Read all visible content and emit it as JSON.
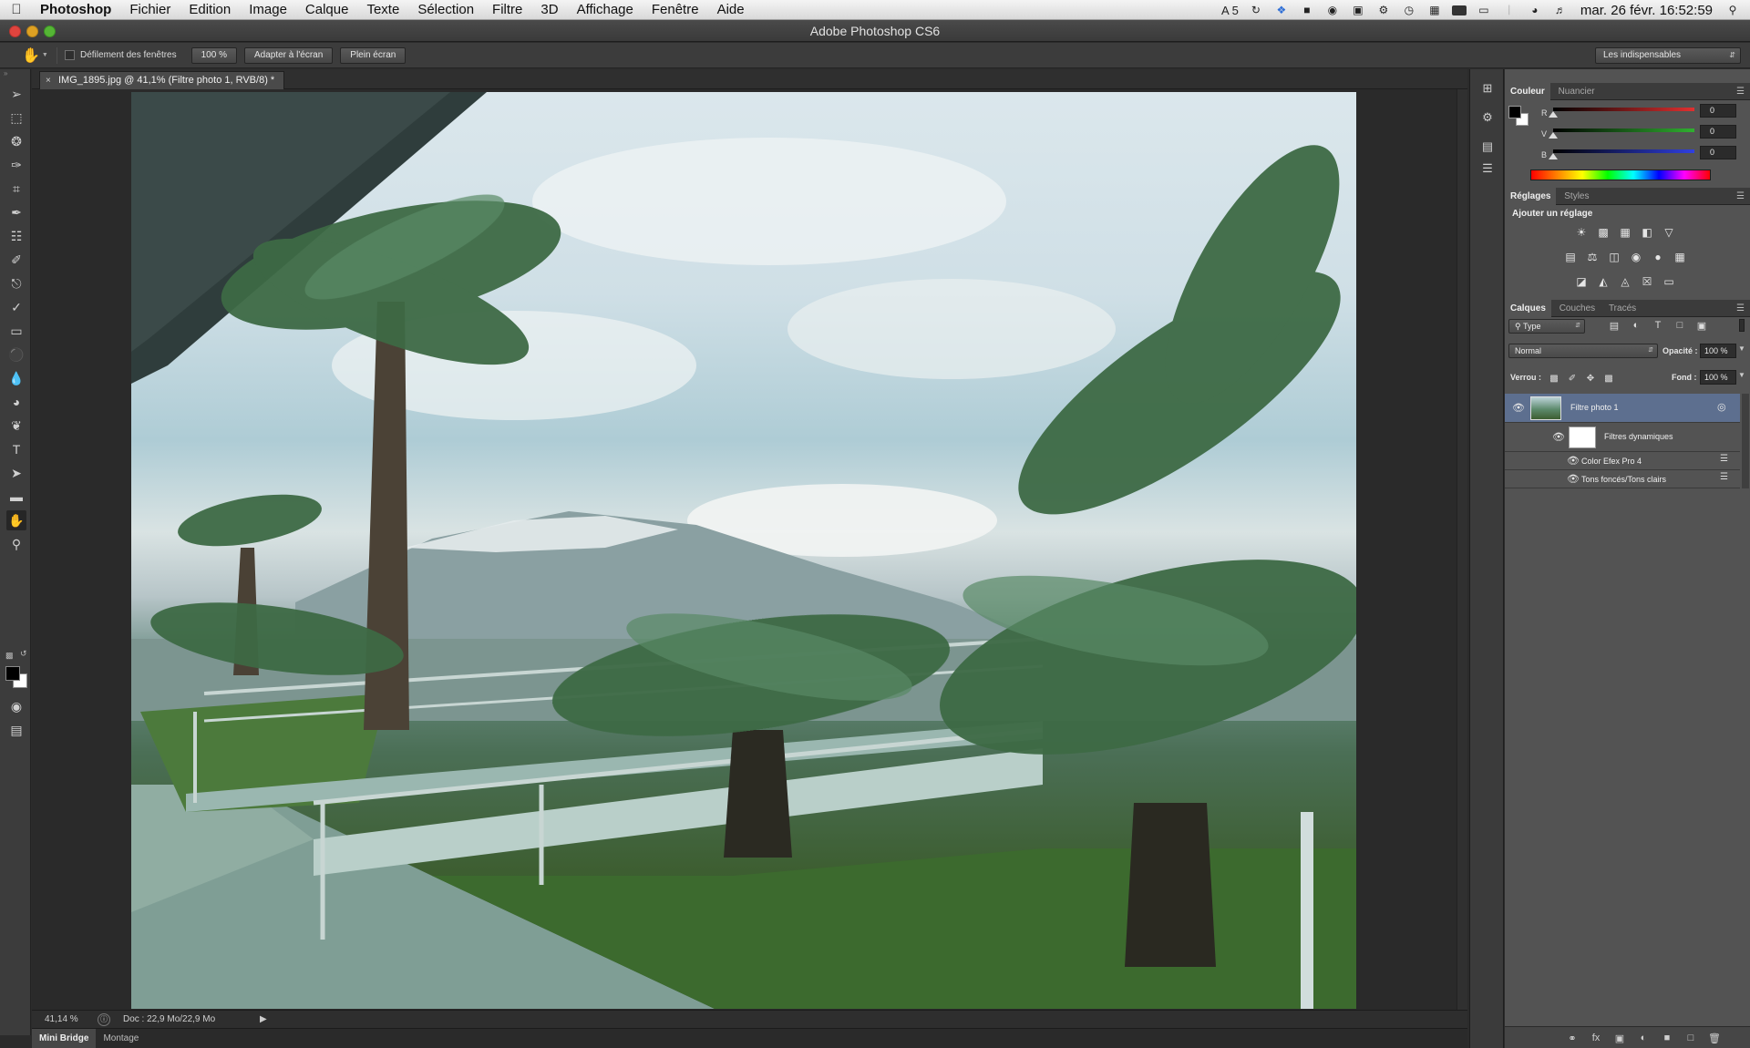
{
  "menubar": {
    "app_name": "Photoshop",
    "items": [
      "Fichier",
      "Edition",
      "Image",
      "Calque",
      "Texte",
      "Sélection",
      "Filtre",
      "3D",
      "Affichage",
      "Fenêtre",
      "Aide"
    ],
    "status_text": "5",
    "clock": "mar. 26 févr.  16:52:59"
  },
  "window": {
    "title": "Adobe Photoshop CS6"
  },
  "options": {
    "scroll_all_windows_label": "Défilement des fenêtres",
    "zoom_100_label": "100 %",
    "fit_screen_label": "Adapter à l'écran",
    "fill_screen_label": "Plein écran",
    "workspace": "Les indispensables"
  },
  "document": {
    "tab_title": "IMG_1895.jpg @ 41,1% (Filtre photo 1, RVB/8) *"
  },
  "statusbar": {
    "zoom": "41,14 %",
    "doc_size": "Doc : 22,9 Mo/22,9 Mo"
  },
  "bottom_tabs": [
    "Mini Bridge",
    "Montage"
  ],
  "color_panel": {
    "tabs": [
      "Couleur",
      "Nuancier"
    ],
    "channels": [
      {
        "label": "R",
        "value": "0",
        "color": "#e03030"
      },
      {
        "label": "V",
        "value": "0",
        "color": "#30b030"
      },
      {
        "label": "B",
        "value": "0",
        "color": "#3040e0"
      }
    ]
  },
  "adjustments_panel": {
    "tabs": [
      "Réglages",
      "Styles"
    ],
    "title": "Ajouter un réglage"
  },
  "layers_panel": {
    "tabs": [
      "Calques",
      "Couches",
      "Tracés"
    ],
    "filter_kind": "Type",
    "blend_mode": "Normal",
    "opacity_label": "Opacité :",
    "opacity": "100 %",
    "lock_label": "Verrou :",
    "fill_label": "Fond :",
    "fill": "100 %",
    "layers": [
      {
        "name": "Filtre photo 1"
      },
      {
        "name": "Filtres dynamiques"
      },
      {
        "name": "Color Efex Pro 4"
      },
      {
        "name": "Tons foncés/Tons clairs"
      }
    ]
  }
}
